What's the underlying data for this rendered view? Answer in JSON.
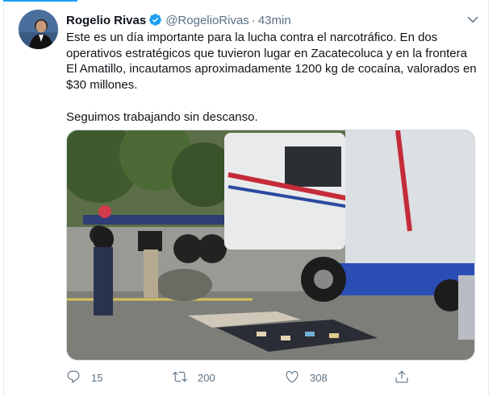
{
  "tweet": {
    "author_name": "Rogelio Rivas",
    "handle": "@RogelioRivas",
    "separator": "·",
    "time": "43min",
    "body": "Este es un día importante para la lucha contra el narcotráfico. En dos\noperativos estratégicos que tuvieron lugar en Zacatecoluca y en la frontera\nEl Amatillo, incautamos aproximadamente 1200 kg de cocaína, valorados en\n$30 millones.\n\nSeguimos trabajando sin descanso.",
    "media_icon": "photo",
    "actions": {
      "reply": {
        "icon": "reply-icon",
        "count": "15"
      },
      "retweet": {
        "icon": "retweet-icon",
        "count": "200"
      },
      "like": {
        "icon": "heart-icon",
        "count": "308"
      },
      "share": {
        "icon": "share-icon"
      }
    }
  },
  "colors": {
    "accent": "#1da1f2",
    "text_primary": "#0f1419",
    "text_secondary": "#5b7083",
    "border": "#e6ecf0"
  }
}
